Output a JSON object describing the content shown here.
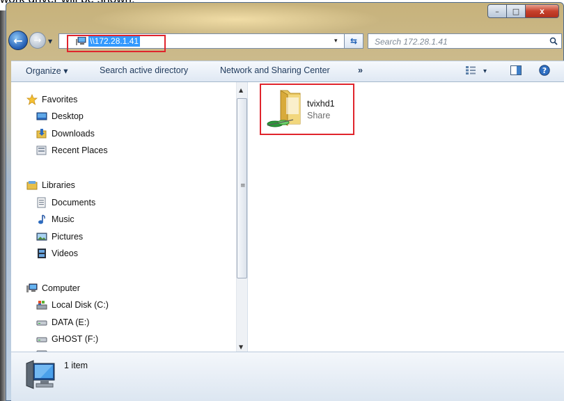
{
  "doc_caption": "work driver will be shown.",
  "window": {
    "caption_buttons": {
      "minimize": "–",
      "maximize": "□",
      "close": "x"
    }
  },
  "address_bar": {
    "path": "\\\\172.28.1.41",
    "dropdown": "▾",
    "refresh": "⇆"
  },
  "search": {
    "placeholder": "Search 172.28.1.41"
  },
  "toolbar": {
    "organize": "Organize ▾",
    "search_ad": "Search active directory",
    "network_center": "Network and Sharing Center",
    "more": "»",
    "view_options": "▾"
  },
  "nav": {
    "favorites": {
      "label": "Favorites",
      "items": [
        "Desktop",
        "Downloads",
        "Recent Places"
      ]
    },
    "libraries": {
      "label": "Libraries",
      "items": [
        "Documents",
        "Music",
        "Pictures",
        "Videos"
      ]
    },
    "computer": {
      "label": "Computer",
      "items": [
        "Local Disk (C:)",
        "DATA (E:)",
        "GHOST (F:)"
      ]
    }
  },
  "content": {
    "items": [
      {
        "name": "tvixhd1",
        "type": "Share"
      }
    ]
  },
  "status": {
    "count": "1 item"
  },
  "colors": {
    "highlight_box": "#e0242c",
    "selection": "#3399ff",
    "link_text": "#1e395b"
  }
}
